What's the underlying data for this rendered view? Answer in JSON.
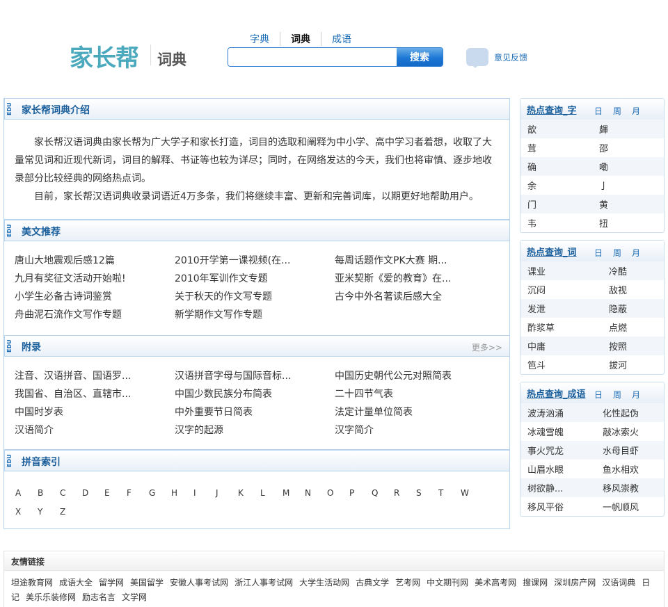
{
  "header": {
    "logo": "家长帮",
    "logo_sub": "词典",
    "nav": [
      "字典",
      "词典",
      "成语"
    ],
    "search_placeholder": "",
    "search_button": "搜索",
    "feedback": "意见反馈"
  },
  "edu": "EDU",
  "intro": {
    "title": "家长帮词典介绍",
    "paragraphs": [
      "家长帮汉语词典由家长帮为广大学子和家长打造，词目的选取和阐释为中小学、高中学习者着想，收取了大量常见词和近现代新词，词目的解释、书证等也较为详尽；同时，在网络发达的今天，我们也将审慎、逐步地收录部分比较经典的网络热点词。",
      "目前，家长帮汉语词典收录词语近4万多条，我们将继续丰富、更新和完善词库，以期更好地帮助用户。"
    ]
  },
  "articles": {
    "title": "美文推荐",
    "items": [
      "唐山大地震观后感12篇",
      "2010开学第一课视频(在...",
      "每周话题作文PK大赛 期...",
      "九月有奖征文活动开始啦!",
      "2010年军训作文专题",
      "亚米契斯《爱的教育》在...",
      "小学生必备古诗词鉴赏",
      "关于秋天的作文写专题",
      "古今中外名著读后感大全",
      "舟曲泥石流作文写作专题",
      "新学期作文写作专题"
    ]
  },
  "appendix": {
    "title": "附录",
    "more": "更多>>",
    "items": [
      "注音、汉语拼音、国语罗...",
      "汉语拼音字母与国际音标...",
      "中国历史朝代公元对照简表",
      "我国省、自治区、直辖市...",
      "中国少数民族分布简表",
      "二十四节气表",
      "中国时岁表",
      "中外重要节日简表",
      "法定计量单位简表",
      "汉语简介",
      "汉字的起源",
      "汉字简介"
    ]
  },
  "pinyin": {
    "title": "拼音索引",
    "letters": [
      "A",
      "B",
      "C",
      "D",
      "E",
      "F",
      "G",
      "H",
      "I",
      "J",
      "K",
      "L",
      "M",
      "N",
      "O",
      "P",
      "Q",
      "R",
      "S",
      "T",
      "W",
      "X",
      "Y",
      "Z"
    ]
  },
  "periods": [
    "日",
    "周",
    "月"
  ],
  "hot": [
    {
      "title": "热点查询_字",
      "items": [
        [
          "歆",
          "皹"
        ],
        [
          "茸",
          "邵"
        ],
        [
          "确",
          "嘞"
        ],
        [
          "余",
          "亅"
        ],
        [
          "门",
          "黄"
        ],
        [
          "韦",
          "扭"
        ]
      ]
    },
    {
      "title": "热点查询_词",
      "items": [
        [
          "课业",
          "冷酷"
        ],
        [
          "沉闷",
          "敌视"
        ],
        [
          "发泄",
          "隐蔽"
        ],
        [
          "酢浆草",
          "点燃"
        ],
        [
          "中庸",
          "按照"
        ],
        [
          "笆斗",
          "拔河"
        ]
      ]
    },
    {
      "title": "热点查询_成语",
      "items": [
        [
          "波涛汹涌",
          "化性起伪"
        ],
        [
          "冰魂雪魄",
          "敲冰索火"
        ],
        [
          "事火咒龙",
          "水母目虾"
        ],
        [
          "山眉水眼",
          "鱼水相欢"
        ],
        [
          "树欲静...",
          "移风崇教"
        ],
        [
          "移风平俗",
          "一帆顺风"
        ]
      ]
    }
  ],
  "footer": {
    "title": "友情链接",
    "links": [
      "坦途教育网",
      "成语大全",
      "留学网",
      "美国留学",
      "安徽人事考试网",
      "浙江人事考试网",
      "大学生活动网",
      "古典文学",
      "艺考网",
      "中文期刊网",
      "美术高考网",
      "搜课网",
      "深圳房产网",
      "汉语词典",
      "日记",
      "美乐乐装修网",
      "励志名言",
      "文学网"
    ]
  }
}
